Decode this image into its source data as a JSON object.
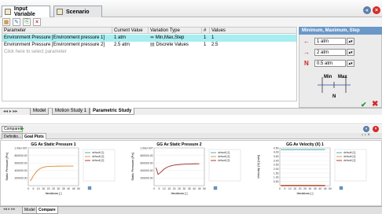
{
  "top_tabs": [
    {
      "label": "Input Variable",
      "active": true
    },
    {
      "label": "Scenario",
      "active": false
    }
  ],
  "grid": {
    "headers": [
      "Parameter",
      "Current Value",
      "Variation Type",
      "#",
      "Values"
    ],
    "rows": [
      {
        "parameter": "Environment Pressure [Environment pressure 1]",
        "current_value": "1 atm",
        "variation_type": "Min,Max,Step",
        "count": "1",
        "values": "1",
        "selected": true
      },
      {
        "parameter": "Environment Pressure [Environment pressure 2]",
        "current_value": "2.5 atm",
        "variation_type": "Discrete Values",
        "count": "1",
        "values": "2.5",
        "selected": false
      }
    ],
    "add_hint": "Click here to select parameter"
  },
  "right_panel": {
    "title": "Minimum, Maximum, Step",
    "min_value": "1 atm",
    "max_value": "2 atm",
    "step_label": "N",
    "step_value": "0.5 atm",
    "diagram_min": "Min",
    "diagram_max": "Max",
    "diagram_n": "N"
  },
  "mid_tabs": [
    {
      "label": "Model",
      "active": false
    },
    {
      "label": "Motion Study 1",
      "active": false
    },
    {
      "label": "Parametric Study",
      "active": true
    }
  ],
  "bottom_panel": {
    "compare_label": "Compare",
    "tabs": [
      {
        "label": "Definitio...",
        "active": false
      },
      {
        "label": "Goal Plots",
        "active": true
      }
    ],
    "status_tabs": [
      {
        "label": "Model",
        "active": false
      },
      {
        "label": "Compare",
        "active": true
      }
    ]
  },
  "colors": {
    "selection": "#a6eef1",
    "panel_header": "#6a98c9",
    "orange": "#e08a2d",
    "darkred": "#9f2a2a",
    "teal": "#3aa6a8"
  },
  "chart_data": [
    {
      "type": "line",
      "title": "GG Av Static Pressure 1",
      "xlabel": "Iterations [ ]",
      "ylabel": "Static Pressure [Pa]",
      "x_ticks": [
        "0",
        "5",
        "10",
        "15",
        "20",
        "25",
        "30",
        "35",
        "40",
        "45",
        "50"
      ],
      "y_ticks": [
        "200000.00",
        "400000.00",
        "600000.00",
        "800000.00",
        "1.00e+007"
      ],
      "ylim": [
        0,
        1000000
      ],
      "series": [
        {
          "name": "default [1]",
          "color": "#3aa6a8",
          "x": [],
          "values": []
        },
        {
          "name": "default [2]",
          "color": "#e08a2d",
          "x": [
            2,
            5,
            8,
            11,
            14,
            17,
            20,
            25,
            30,
            35,
            40,
            45
          ],
          "values": [
            120000,
            260000,
            370000,
            440000,
            480000,
            500000,
            510000,
            515000,
            518000,
            520000,
            520000,
            520000
          ]
        },
        {
          "name": "default [2]",
          "color": "#9f2a2a",
          "x": [],
          "values": []
        }
      ]
    },
    {
      "type": "line",
      "title": "GG Av Static Pressure 2",
      "xlabel": "Iterations [ ]",
      "ylabel": "Static Pressure [Pa]",
      "x_ticks": [
        "0",
        "5",
        "10",
        "15",
        "20",
        "25",
        "30",
        "35",
        "40",
        "45",
        "50"
      ],
      "y_ticks": [
        "200000.00",
        "400000.00",
        "600000.00",
        "800000.00",
        "1.00e+007"
      ],
      "ylim": [
        0,
        1000000
      ],
      "series": [
        {
          "name": "default [1]",
          "color": "#3aa6a8",
          "x": [],
          "values": []
        },
        {
          "name": "default [2]",
          "color": "#e08a2d",
          "x": [],
          "values": []
        },
        {
          "name": "default [2]",
          "color": "#9f2a2a",
          "x": [
            2,
            4,
            6,
            8,
            10,
            13,
            16,
            20,
            25,
            30,
            35,
            40,
            45
          ],
          "values": [
            480000,
            300000,
            340000,
            390000,
            440000,
            490000,
            520000,
            545000,
            560000,
            570000,
            575000,
            578000,
            580000
          ]
        }
      ]
    },
    {
      "type": "line",
      "title": "GG Av Velocity (X) 1",
      "xlabel": "Iterations [ ]",
      "ylabel": "Velocity (X) [m/s]",
      "x_ticks": [
        "0",
        "5",
        "10",
        "15",
        "20",
        "25",
        "30",
        "35",
        "40",
        "45",
        "50"
      ],
      "y_ticks": [
        "0.50",
        "1.00",
        "1.50",
        "2.00",
        "2.50",
        "3.00",
        "3.50",
        "4.00",
        "4.50"
      ],
      "ylim": [
        0,
        4.5
      ],
      "series": [
        {
          "name": "default [1]",
          "color": "#3aa6a8",
          "x": [
            1,
            5,
            10,
            15,
            20,
            25,
            30,
            35,
            40,
            45
          ],
          "values": [
            4.3,
            4.3,
            4.3,
            4.3,
            4.3,
            4.3,
            4.3,
            4.3,
            4.3,
            4.3
          ]
        },
        {
          "name": "default [2]",
          "color": "#e08a2d",
          "x": [
            1,
            5,
            10,
            15,
            20,
            25,
            30,
            35,
            40,
            45
          ],
          "values": [
            0.05,
            0.05,
            0.05,
            0.05,
            0.05,
            0.05,
            0.05,
            0.05,
            0.05,
            0.05
          ]
        },
        {
          "name": "default [2]",
          "color": "#9f2a2a",
          "x": [
            1,
            5,
            10,
            15,
            20,
            25,
            30,
            35,
            40,
            45
          ],
          "values": [
            0.0,
            0.0,
            0.0,
            0.0,
            0.0,
            0.0,
            0.0,
            0.0,
            0.0,
            0.0
          ]
        }
      ]
    }
  ]
}
